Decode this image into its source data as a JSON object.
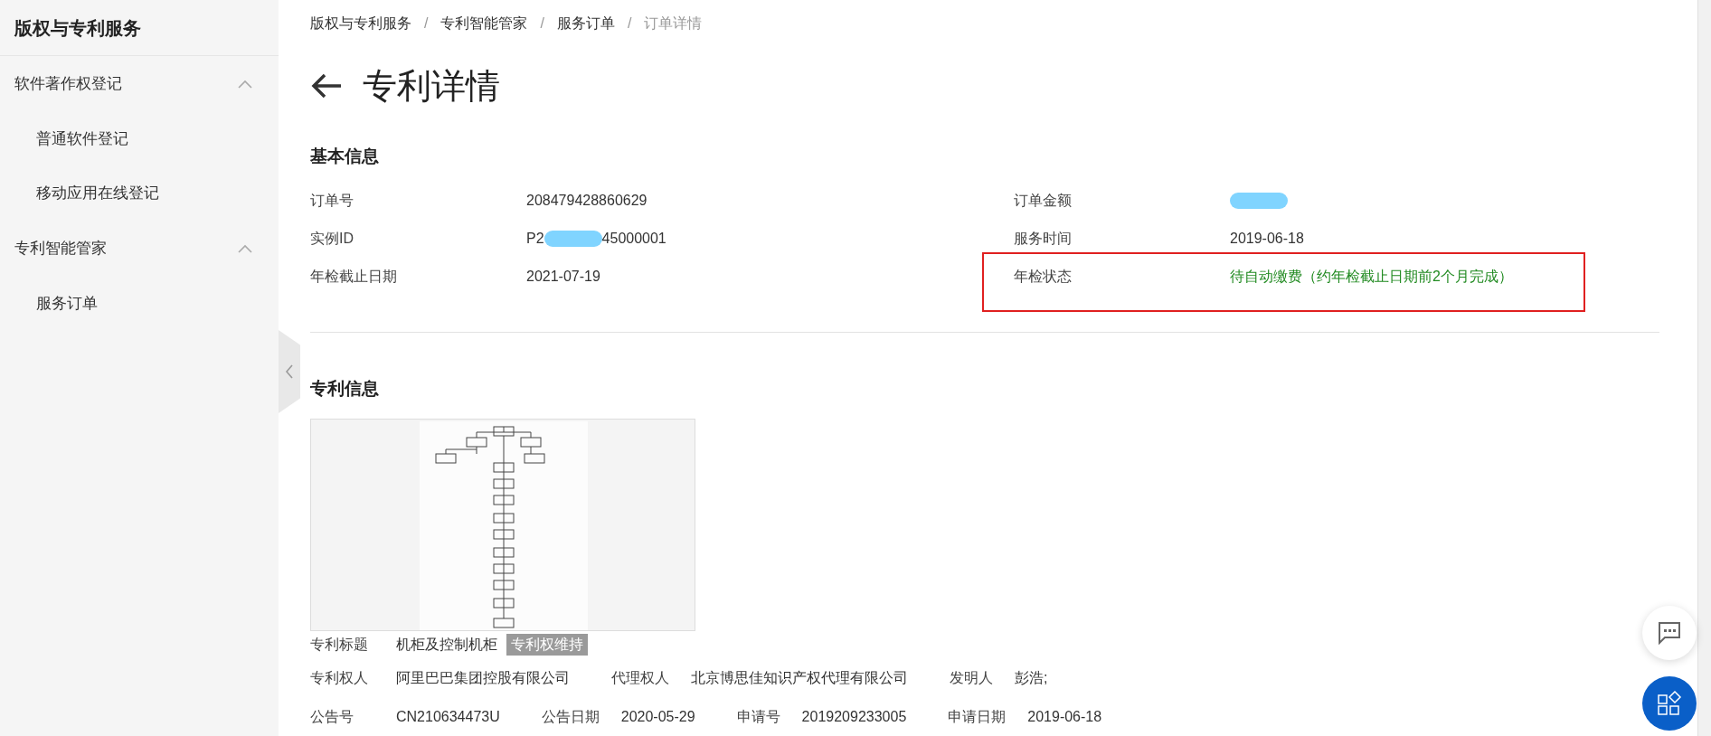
{
  "sidebar": {
    "title": "版权与专利服务",
    "groups": [
      {
        "label": "软件著作权登记",
        "expanded": true,
        "children": [
          {
            "label": "普通软件登记"
          },
          {
            "label": "移动应用在线登记"
          }
        ]
      },
      {
        "label": "专利智能管家",
        "expanded": true,
        "children": [
          {
            "label": "服务订单"
          }
        ]
      }
    ]
  },
  "breadcrumb": [
    {
      "label": "版权与专利服务",
      "current": false
    },
    {
      "separator": "/",
      "label": "专利智能管家",
      "current": false
    },
    {
      "separator": "/",
      "label": "服务订单",
      "current": false
    },
    {
      "separator": "/",
      "label": "订单详情",
      "current": true
    }
  ],
  "page_title": "专利详情",
  "basic_info": {
    "title": "基本信息",
    "fields": [
      {
        "label": "订单号",
        "parts": [
          {
            "kind": "text",
            "text": "208479428860629"
          }
        ]
      },
      {
        "label": "订单金额",
        "parts": [
          {
            "kind": "redaction"
          }
        ]
      },
      {
        "label": "实例ID",
        "parts": [
          {
            "kind": "text",
            "text": "P2"
          },
          {
            "kind": "redaction"
          },
          {
            "kind": "text",
            "text": "45000001"
          }
        ]
      },
      {
        "label": "服务时间",
        "parts": [
          {
            "kind": "text",
            "text": "2019-06-18"
          }
        ]
      },
      {
        "label": "年检截止日期",
        "parts": [
          {
            "kind": "text",
            "text": "2021-07-19"
          }
        ]
      },
      {
        "label": "年检状态",
        "color": "#228b22",
        "highlighted": true,
        "parts": [
          {
            "kind": "text",
            "text": "待自动缴费（约年检截止日期前2个月完成）"
          }
        ]
      }
    ]
  },
  "patent_info": {
    "title": "专利信息",
    "image": {
      "kind": "picture"
    },
    "title_row": {
      "label": "专利标题",
      "value": "机柜及控制机柜",
      "tag": "专利权维持"
    },
    "detail_rows": [
      [
        {
          "label": "专利权人",
          "value": "阿里巴巴集团控股有限公司"
        },
        {
          "label": "代理权人",
          "value": "北京博思佳知识产权代理有限公司"
        },
        {
          "label": "发明人",
          "value": "彭浩;"
        }
      ],
      [
        {
          "label": "公告号",
          "value": "CN210634473U"
        },
        {
          "label": "公告日期",
          "value": "2020-05-29"
        },
        {
          "label": "申请号",
          "value": "2019209233005"
        },
        {
          "label": "申请日期",
          "value": "2019-06-18"
        }
      ]
    ]
  }
}
